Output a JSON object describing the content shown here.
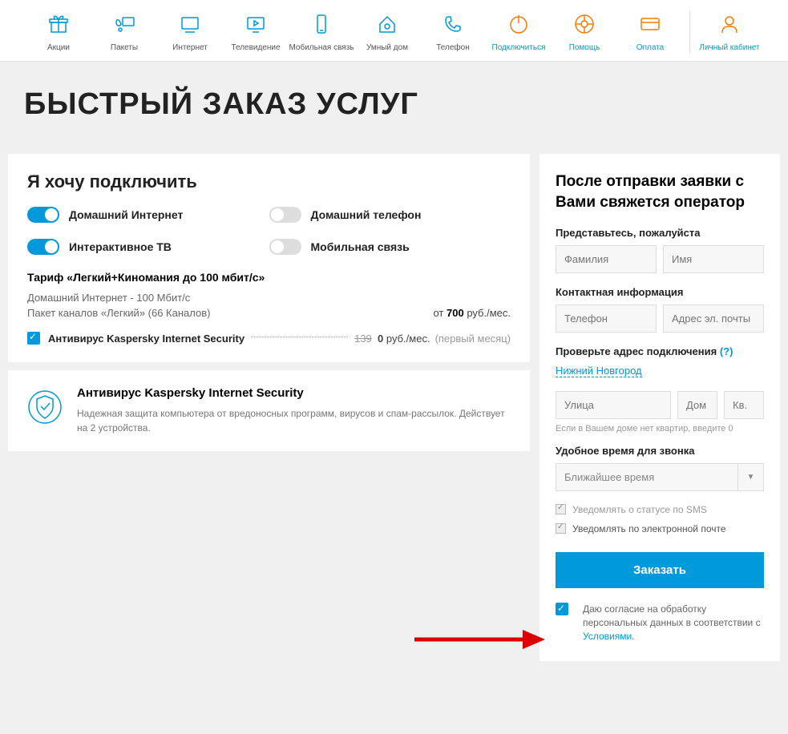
{
  "nav": [
    {
      "label": "Акции",
      "name": "nav-promo"
    },
    {
      "label": "Пакеты",
      "name": "nav-packages"
    },
    {
      "label": "Интернет",
      "name": "nav-internet"
    },
    {
      "label": "Телевидение",
      "name": "nav-tv"
    },
    {
      "label": "Мобильная связь",
      "name": "nav-mobile"
    },
    {
      "label": "Умный дом",
      "name": "nav-smarthome"
    },
    {
      "label": "Телефон",
      "name": "nav-phone"
    },
    {
      "label": "Подключиться",
      "name": "nav-connect",
      "orange": true,
      "labelBlue": true
    },
    {
      "label": "Помощь",
      "name": "nav-help",
      "orange": true
    },
    {
      "label": "Оплата",
      "name": "nav-payment",
      "orange": true
    },
    {
      "label": "Личный кабинет",
      "name": "nav-account",
      "orange": true,
      "divider": true
    }
  ],
  "pageTitle": "БЫСТРЫЙ ЗАКАЗ УСЛУГ",
  "wantTitle": "Я хочу подключить",
  "toggles": [
    {
      "label": "Домашний Интернет",
      "on": true
    },
    {
      "label": "Домашний телефон",
      "on": false
    },
    {
      "label": "Интерактивное ТВ",
      "on": true
    },
    {
      "label": "Мобильная связь",
      "on": false
    }
  ],
  "tariff": {
    "name": "Тариф «Легкий+Киномания до 100 мбит/с»",
    "line1": "Домашний Интернет - 100 Мбит/с",
    "line2": "Пакет каналов «Легкий» (66 Каналов)",
    "priceFrom": "от ",
    "priceValue": "700",
    "priceUnit": " руб./мес."
  },
  "addon": {
    "name": "Антивирус Kaspersky Internet Security",
    "old": "139",
    "new": "0",
    "unit": " руб./мес. ",
    "note": "(первый месяц)"
  },
  "info": {
    "title": "Антивирус Kaspersky Internet Security",
    "desc": "Надежная защита компьютера от вредоносных программ, вирусов и спам-рассылок. Действует на 2 устройства."
  },
  "form": {
    "heading": "После отправки заявки с Вами свяжется оператор",
    "introLabel": "Представьтесь, пожалуйста",
    "lastName": "Фамилия",
    "firstName": "Имя",
    "contactLabel": "Контактная информация",
    "phone": "Телефон",
    "email": "Адрес эл. почты",
    "addressLabel": "Проверьте адрес подключения ",
    "addressHelp": "(?)",
    "city": "Нижний Новгород",
    "street": "Улица",
    "house": "Дом",
    "apt": "Кв.",
    "hint": "Если в Вашем доме нет квартир, введите 0",
    "timeLabel": "Удобное время для звонка",
    "timeValue": "Ближайшее время",
    "smsNotify": "Уведомлять о статусе по SMS",
    "emailNotify": "Уведомлять по электронной почте",
    "orderBtn": "Заказать",
    "consent1": "Даю согласие на обработку персональных данных в соответствии с ",
    "consentLink": "Условиями",
    "consent2": "."
  }
}
